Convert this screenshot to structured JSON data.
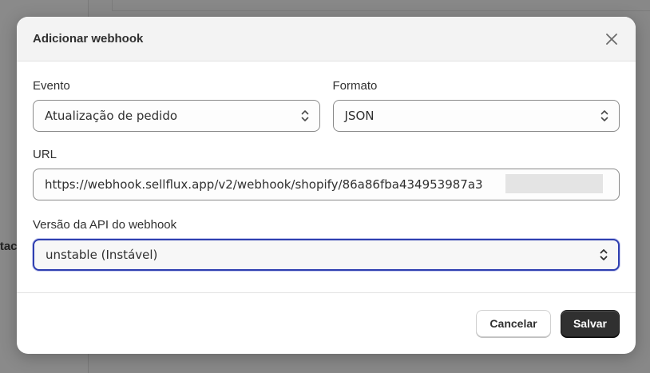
{
  "background": {
    "partial_text": "rtac"
  },
  "modal": {
    "title": "Adicionar webhook",
    "close_icon": "close-icon",
    "fields": {
      "event": {
        "label": "Evento",
        "value": "Atualização de pedido"
      },
      "format": {
        "label": "Formato",
        "value": "JSON"
      },
      "url": {
        "label": "URL",
        "value": "https://webhook.sellflux.app/v2/webhook/shopify/86a86fba434953987a3"
      },
      "api_version": {
        "label": "Versão da API do webhook",
        "value": "unstable (Instável)"
      }
    },
    "buttons": {
      "cancel": "Cancelar",
      "save": "Salvar"
    }
  },
  "colors": {
    "focus_ring": "#2f3fb0",
    "primary_button": "#303030",
    "overlay": "#8a8a8a"
  }
}
